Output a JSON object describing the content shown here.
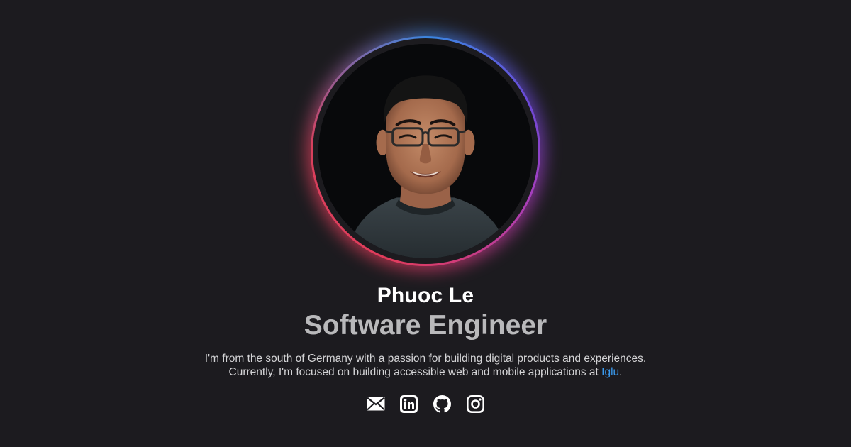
{
  "profile": {
    "name": "Phuoc Le",
    "title": "Software Engineer",
    "bio_line1": "I'm from the south of Germany with a passion for building digital products and experiences.",
    "bio_line2_prefix": "Currently, I'm focused on building accessible web and mobile applications at ",
    "company_link": "Iglu",
    "bio_line2_suffix": "."
  },
  "socials": [
    {
      "icon": "mail-icon"
    },
    {
      "icon": "linkedin-icon"
    },
    {
      "icon": "github-icon"
    },
    {
      "icon": "instagram-icon"
    }
  ],
  "colors": {
    "background": "#1c1b1f",
    "name": "#ffffff",
    "title": "#b9b9bb",
    "bio": "#d4d4d6",
    "link": "#3a9bf0",
    "ring_blue": "#3a86e0",
    "ring_purple": "#a43fc0",
    "ring_red": "#e23c5b"
  }
}
